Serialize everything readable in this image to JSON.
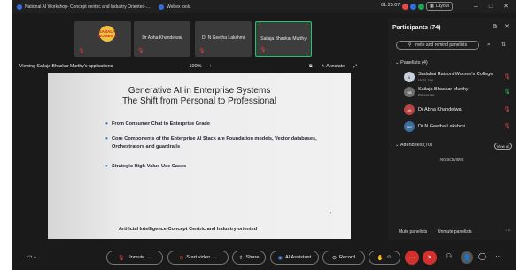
{
  "tabs": [
    {
      "label": "National AI Workshop- Concept centric and Industry Oriented-..."
    },
    {
      "label": "Webex tools"
    }
  ],
  "clock": "01:25:07",
  "layout_label": "Layout",
  "tiles": [
    {
      "name": "SABALA WOMEN'S"
    },
    {
      "name": "Dr Abha Khandelwal"
    },
    {
      "name": "Dr N Geetha Lakshmi"
    },
    {
      "name": "Sailaja Bhaskar Murthy"
    }
  ],
  "viewing_label": "Viewing Sailaja Bhaskar Murthy's applications",
  "zoom": {
    "minus": "—",
    "level": "100%",
    "plus": "+"
  },
  "annotate_label": "Annotate",
  "slide": {
    "title_line1": "Generative AI in Enterprise Systems",
    "title_line2": "The Shift from Personal to Professional",
    "bullets": [
      "From Consumer Chat to Enterprise Grade",
      "Core Components of the Enterprise AI Stack are Foundation models, Vector databases, Orchestrators and guardrails",
      "Strategic High-Value Use Cases"
    ],
    "footer": "Artificial Intelligence-Concept Centric and Industry-oriented"
  },
  "panel": {
    "title": "Participants (74)",
    "invite_label": "Invite and remind panelists",
    "panelists_header": "Panelists (4)",
    "panelists": [
      {
        "name": "Sadabai Raisoni Women's College",
        "role": "Host, me",
        "avatar_color": "#c7d2e0"
      },
      {
        "name": "Sailaja Bhaskar Murthy",
        "role": "Presenter",
        "avatar_color": "#6e6e6e"
      },
      {
        "name": "Dr Abha Khandelwal",
        "role": "",
        "avatar_color": "#b7443f"
      },
      {
        "name": "Dr N Geetha Lakshmi",
        "role": "",
        "avatar_color": "#3d6e9f"
      }
    ],
    "attendees_header": "Attendees (70)",
    "view_all_label": "View all",
    "no_activities": "No activities",
    "mute_panelists": "Mute panelists",
    "unmute_panelists": "Unmute panelists"
  },
  "toolbar": {
    "unmute": "Unmute",
    "start_video": "Start video",
    "share": "Share",
    "ai_assistant": "AI Assistant",
    "record": "Record"
  },
  "colors": {
    "accent_green": "#22c36a",
    "mute_red": "#e04a4a",
    "end_red": "#d2302d"
  }
}
